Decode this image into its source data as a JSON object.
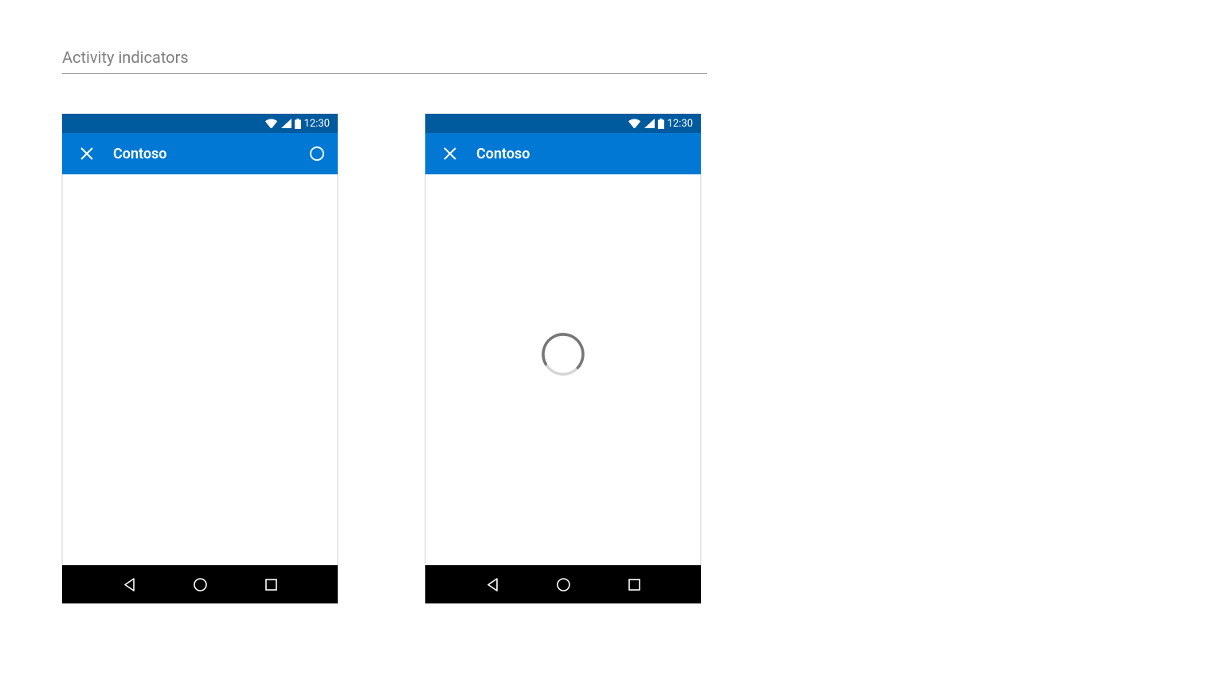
{
  "section": {
    "title": "Activity indicators"
  },
  "status": {
    "time": "12:30"
  },
  "appbar": {
    "title": "Contoso"
  },
  "frames": [
    {
      "showAppBarSpinner": true,
      "showContentSpinner": false
    },
    {
      "showAppBarSpinner": false,
      "showContentSpinner": true
    }
  ]
}
